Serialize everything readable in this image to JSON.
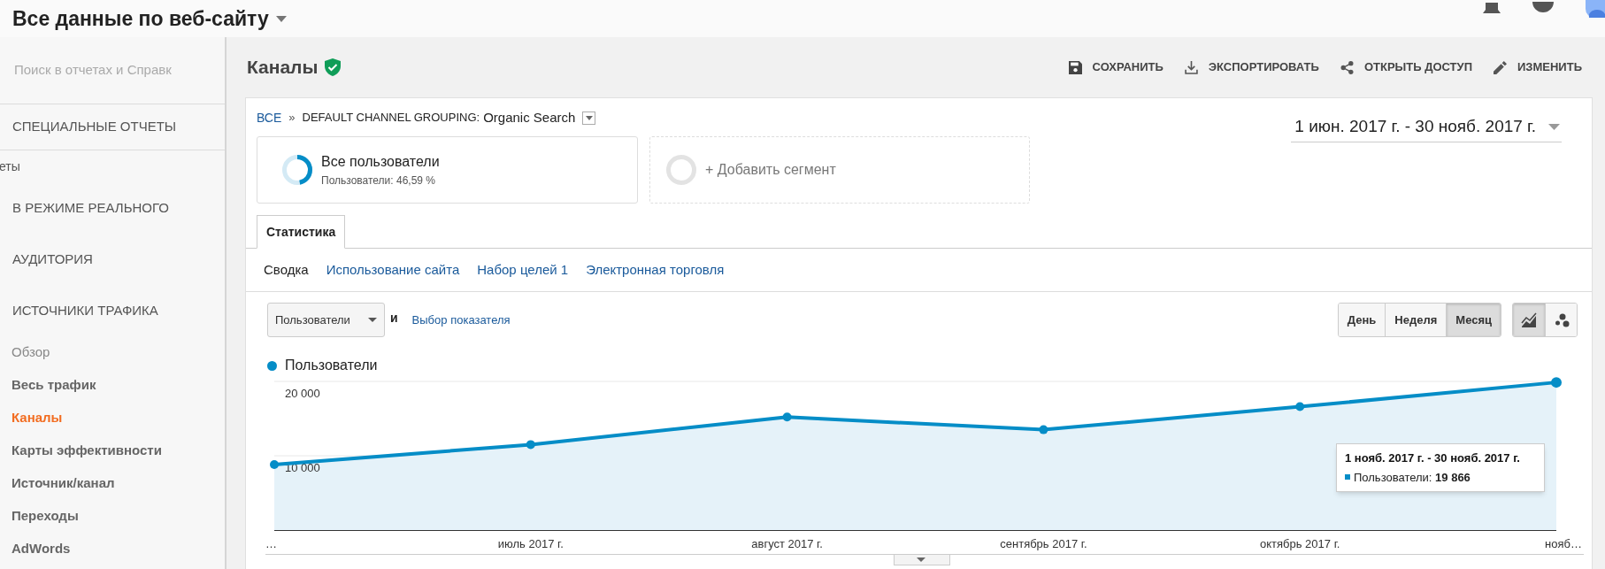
{
  "top_bar": {
    "title": "Все данные по веб-сайту"
  },
  "sidebar": {
    "search": {
      "placeholder": "Поиск в отчетах и Справк"
    },
    "items": [
      {
        "kind": "header",
        "label": "СПЕЦИАЛЬНЫЕ ОТЧЕТЫ"
      },
      {
        "kind": "fragment",
        "label": "еты"
      },
      {
        "kind": "header",
        "label": "В РЕЖИМЕ РЕАЛЬНОГО"
      },
      {
        "kind": "header",
        "label": "АУДИТОРИЯ"
      },
      {
        "kind": "header",
        "label": "ИСТОЧНИКИ ТРАФИКА"
      },
      {
        "kind": "plain",
        "label": "Обзор",
        "selected": false
      },
      {
        "kind": "link",
        "label": "Весь трафик",
        "selected": false
      },
      {
        "kind": "link",
        "label": "Каналы",
        "selected": true
      },
      {
        "kind": "link",
        "label": "Карты эффективности",
        "selected": false
      },
      {
        "kind": "link",
        "label": "Источник/канал",
        "selected": false
      },
      {
        "kind": "link",
        "label": "Переходы",
        "selected": false
      },
      {
        "kind": "link",
        "label": "AdWords",
        "selected": false
      }
    ]
  },
  "page": {
    "title": "Каналы",
    "actions": [
      {
        "kind": "save",
        "label": "СОХРАНИТЬ"
      },
      {
        "kind": "export",
        "label": "ЭКСПОРТИРОВАТЬ"
      },
      {
        "kind": "share",
        "label": "ОТКРЫТЬ ДОСТУП"
      },
      {
        "kind": "edit",
        "label": "ИЗМЕНИТЬ"
      }
    ]
  },
  "breadcrumb": {
    "root": "ВСЕ",
    "separator": "»",
    "label": "DEFAULT CHANNEL GROUPING:",
    "value": "Organic Search"
  },
  "date_range": "1 июн. 2017 г. - 30 нояб. 2017 г.",
  "segments": [
    {
      "kind": "segment",
      "title": "Все пользователи",
      "subtitle": "Пользователи: 46,59 %",
      "level": 0.4659
    },
    {
      "kind": "add",
      "title": "+ Добавить сегмент"
    }
  ],
  "tabs": [
    {
      "label": "Статистика",
      "selected": true
    }
  ],
  "subtabs": [
    {
      "label": "Сводка",
      "selected": true
    },
    {
      "label": "Использование сайта",
      "selected": false
    },
    {
      "label": "Набор целей 1",
      "selected": false
    },
    {
      "label": "Электронная торговля",
      "selected": false
    }
  ],
  "metric": {
    "dropdown": "Пользователи",
    "conjunction": "и",
    "link": "Выбор показателя"
  },
  "periods": [
    {
      "label": "День",
      "selected": false
    },
    {
      "label": "Неделя",
      "selected": false
    },
    {
      "label": "Месяц",
      "selected": true
    }
  ],
  "chart_types": [
    {
      "kind": "line",
      "selected": true
    },
    {
      "kind": "motion",
      "selected": false
    }
  ],
  "chart": {
    "chart_data": {
      "type": "area",
      "categories": [
        "…",
        "июль 2017 г.",
        "август 2017 г.",
        "сентябрь 2017 г.",
        "октябрь 2017 г.",
        "нояб…"
      ],
      "series": [
        {
          "name": "Пользователи",
          "color": "#058dc7",
          "values": [
            8800,
            11500,
            15200,
            13500,
            16600,
            19866
          ]
        }
      ],
      "ylim": [
        0,
        20000
      ],
      "yticks": [
        {
          "value": 10000,
          "label": "10 000"
        },
        {
          "value": 20000,
          "label": "20 000"
        }
      ]
    },
    "tooltip": {
      "title": "1 нояб. 2017 г. - 30 нояб. 2017 г.",
      "label": "Пользователи:",
      "value": "19 866"
    }
  }
}
